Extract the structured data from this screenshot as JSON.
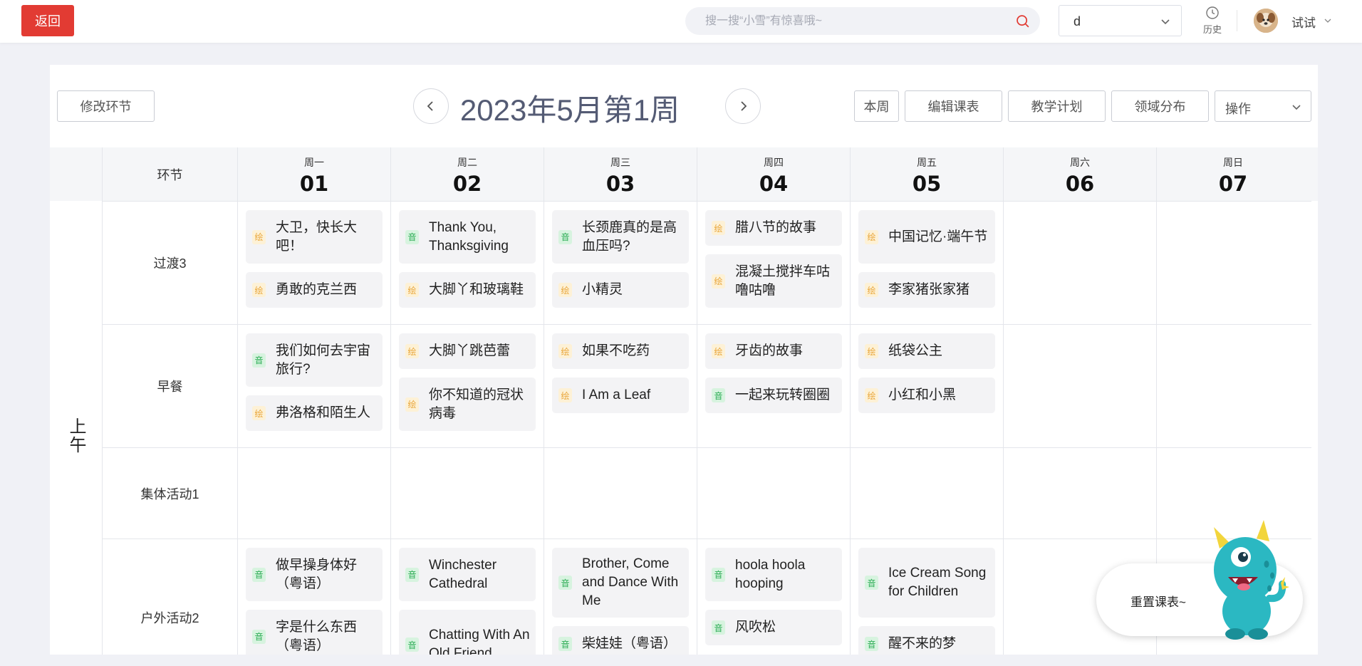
{
  "topbar": {
    "back_label": "返回",
    "search_placeholder": "搜一搜“小雪”有惊喜哦~",
    "class_select_value": "d",
    "history_label": "历史",
    "user_name": "试试"
  },
  "toolbar": {
    "modify_segment": "修改环节",
    "week_title": "2023年5月第1周",
    "this_week": "本周",
    "edit_schedule": "编辑课表",
    "teaching_plan": "教学计划",
    "domain_distribution": "领域分布",
    "operations": "操作"
  },
  "grid": {
    "segment_header": "环节",
    "ampm_label": "上午",
    "days": [
      {
        "weekday": "周一",
        "date": "01"
      },
      {
        "weekday": "周二",
        "date": "02"
      },
      {
        "weekday": "周三",
        "date": "03"
      },
      {
        "weekday": "周四",
        "date": "04"
      },
      {
        "weekday": "周五",
        "date": "05"
      },
      {
        "weekday": "周六",
        "date": "06"
      },
      {
        "weekday": "周日",
        "date": "07"
      }
    ],
    "tag_labels": {
      "hui": "绘",
      "yin": "音"
    },
    "rows": [
      {
        "label": "过渡3",
        "cells": [
          [
            {
              "tag": "hui",
              "title": "大卫，快长大吧！"
            },
            {
              "tag": "hui",
              "title": "勇敢的克兰西"
            }
          ],
          [
            {
              "tag": "yin",
              "title": "Thank You, Thanksgiving"
            },
            {
              "tag": "hui",
              "title": "大脚丫和玻璃鞋"
            }
          ],
          [
            {
              "tag": "yin",
              "title": "长颈鹿真的是高血压吗?"
            },
            {
              "tag": "hui",
              "title": "小精灵"
            }
          ],
          [
            {
              "tag": "hui",
              "title": "腊八节的故事"
            },
            {
              "tag": "hui",
              "title": "混凝土搅拌车咕噜咕噜"
            }
          ],
          [
            {
              "tag": "hui",
              "title": "中国记忆·端午节"
            },
            {
              "tag": "hui",
              "title": "李家猪张家猪"
            }
          ],
          [],
          []
        ]
      },
      {
        "label": "早餐",
        "cells": [
          [
            {
              "tag": "yin",
              "title": "我们如何去宇宙旅行?"
            },
            {
              "tag": "hui",
              "title": "弗洛格和陌生人"
            }
          ],
          [
            {
              "tag": "hui",
              "title": "大脚丫跳芭蕾"
            },
            {
              "tag": "hui",
              "title": "你不知道的冠状病毒"
            }
          ],
          [
            {
              "tag": "hui",
              "title": "如果不吃药"
            },
            {
              "tag": "hui",
              "title": "I Am a Leaf"
            }
          ],
          [
            {
              "tag": "hui",
              "title": "牙齿的故事"
            },
            {
              "tag": "yin",
              "title": "一起来玩转圈圈"
            }
          ],
          [
            {
              "tag": "hui",
              "title": "纸袋公主"
            },
            {
              "tag": "hui",
              "title": "小红和小黑"
            }
          ],
          [],
          []
        ]
      },
      {
        "label": "集体活动1",
        "cells": [
          [],
          [],
          [],
          [],
          [],
          [],
          []
        ]
      },
      {
        "label": "户外活动2",
        "cells": [
          [
            {
              "tag": "yin",
              "title": "做早操身体好（粤语）"
            },
            {
              "tag": "yin",
              "title": "字是什么东西（粤语）"
            }
          ],
          [
            {
              "tag": "yin",
              "title": "Winchester Cathedral"
            },
            {
              "tag": "yin",
              "title": "Chatting With An Old Friend"
            }
          ],
          [
            {
              "tag": "yin",
              "title": "Brother, Come and Dance With Me"
            },
            {
              "tag": "yin",
              "title": "柴娃娃（粤语）"
            }
          ],
          [
            {
              "tag": "yin",
              "title": "hoola hoola hooping"
            },
            {
              "tag": "yin",
              "title": "风吹松"
            }
          ],
          [
            {
              "tag": "yin",
              "title": "Ice Cream Song for Children"
            },
            {
              "tag": "yin",
              "title": "醒不来的梦"
            }
          ],
          [],
          []
        ]
      }
    ]
  },
  "float_widget": {
    "reset_label": "重置课表~"
  }
}
